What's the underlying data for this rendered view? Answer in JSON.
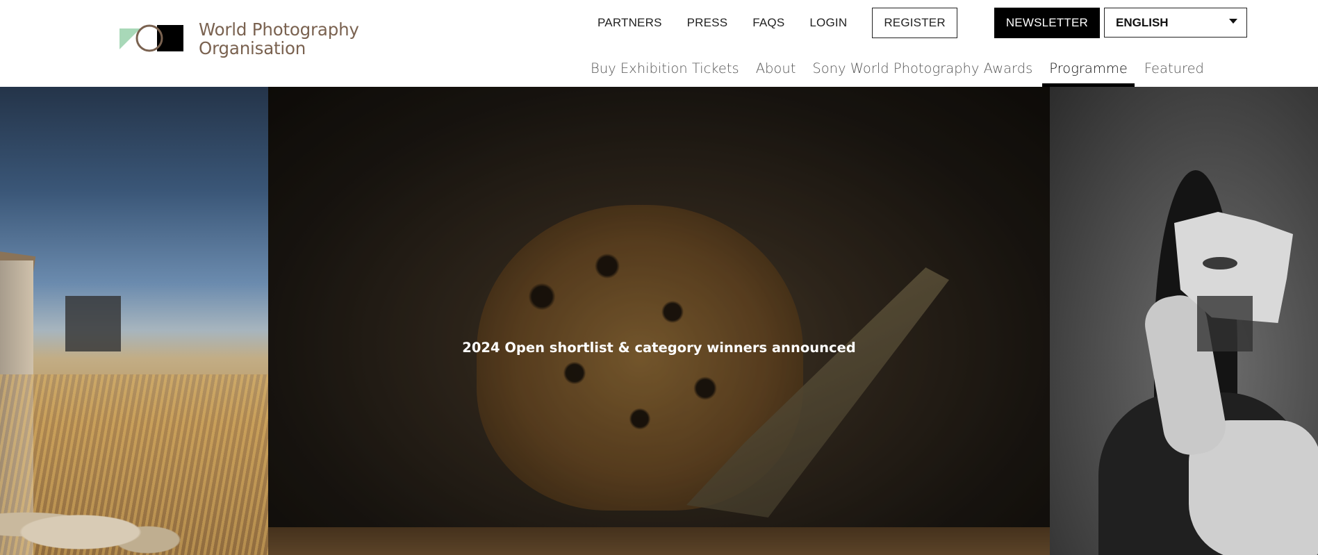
{
  "brand": {
    "line1": "World Photography",
    "line2": "Organisation",
    "colors": {
      "green": "#a8d8b8",
      "brown": "#7a6250",
      "black": "#000000"
    }
  },
  "utility_nav": {
    "partners": "PARTNERS",
    "press": "PRESS",
    "faqs": "FAQS",
    "login": "LOGIN",
    "register": "REGISTER",
    "newsletter": "NEWSLETTER",
    "language": "ENGLISH"
  },
  "main_nav": {
    "items": [
      {
        "label": "Buy Exhibition Tickets"
      },
      {
        "label": "About"
      },
      {
        "label": "Sony World Photography Awards"
      },
      {
        "label": "Programme",
        "active": true
      },
      {
        "label": "Featured"
      }
    ]
  },
  "hero": {
    "caption": "2024 Open shortlist & category winners announced",
    "prev_icon": "arrow-left-icon",
    "next_icon": "arrow-right-icon"
  }
}
